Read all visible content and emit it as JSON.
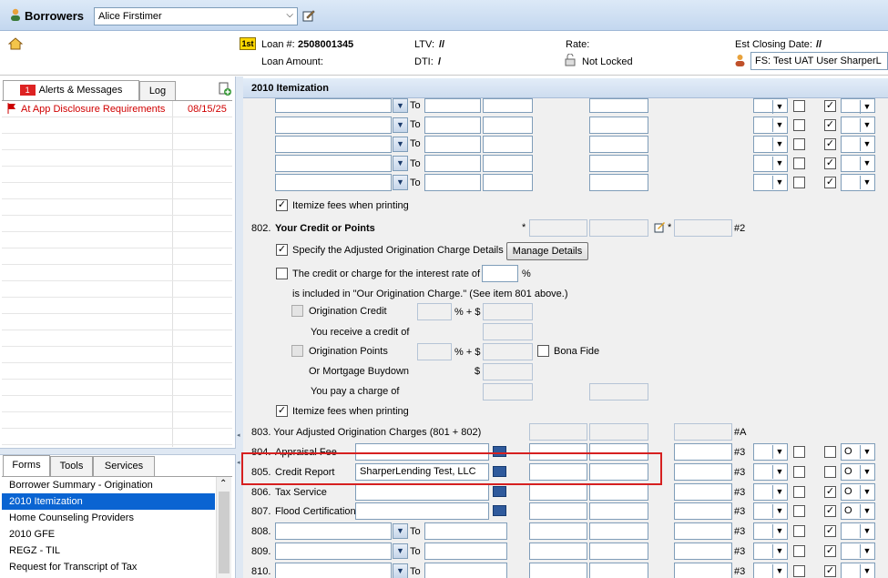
{
  "header": {
    "title": "Borrowers",
    "borrower_select": "Alice Firstimer"
  },
  "info": {
    "loan_badge": "1st",
    "loan_number_label": "Loan #:",
    "loan_number": "2508001345",
    "loan_amount_label": "Loan Amount:",
    "ltv_label": "LTV:",
    "ltv_value": "//",
    "dti_label": "DTI:",
    "dti_value": "/",
    "rate_label": "Rate:",
    "lock_status": "Not Locked",
    "closing_label": "Est Closing Date:",
    "closing_value": "//",
    "user_select": "FS: Test UAT User SharperL"
  },
  "alerts": {
    "tabs": [
      "Alerts & Messages",
      "Log"
    ],
    "badge": "1",
    "items": [
      {
        "text": "At App Disclosure Requirements",
        "date": "08/15/25"
      }
    ]
  },
  "forms": {
    "tabs": [
      "Forms",
      "Tools",
      "Services"
    ],
    "items": [
      "Borrower Summary - Origination",
      "2010 Itemization",
      "Home Counseling Providers",
      "2010 GFE",
      "REGZ - TIL",
      "Request for Transcript of Tax"
    ],
    "selected_index": 1
  },
  "main": {
    "title": "2010 Itemization",
    "to_label": "To",
    "itemize_label": "Itemize fees when printing",
    "s802": {
      "num": "802.",
      "title": "Your Credit or Points",
      "star": "*",
      "ref": "#2",
      "specify_label": "Specify the Adjusted Origination Charge Details",
      "manage_btn": "Manage Details",
      "credit_rate_label": "The credit or charge for the interest rate of",
      "pct": "%",
      "included_label": "is included in \"Our Origination Charge.\" (See item 801 above.)",
      "orig_credit": "Origination Credit",
      "pct_plus": "% + $",
      "receive_credit": "You receive a credit of",
      "orig_points": "Origination Points",
      "bona_fide": "Bona Fide",
      "or_buydown": "Or Mortgage Buydown",
      "dollar": "$",
      "pay_charge": "You pay a charge of"
    },
    "s803": {
      "label": "803.  Your Adjusted Origination Charges (801 + 802)",
      "ref": "#A"
    },
    "rows": [
      {
        "num": "804.",
        "label": "Appraisal Fee",
        "payee": "",
        "ref": "#3",
        "sel": "O"
      },
      {
        "num": "805.",
        "label": "Credit Report",
        "payee": "SharperLending Test, LLC",
        "ref": "#3",
        "sel": "O"
      },
      {
        "num": "806.",
        "label": "Tax Service",
        "payee": "",
        "ref": "#3",
        "sel": "O"
      },
      {
        "num": "807.",
        "label": "Flood Certification",
        "payee": "",
        "ref": "#3",
        "sel": "O"
      },
      {
        "num": "808.",
        "ref": "#3"
      },
      {
        "num": "809.",
        "ref": "#3"
      },
      {
        "num": "810.",
        "ref": "#3"
      }
    ]
  }
}
